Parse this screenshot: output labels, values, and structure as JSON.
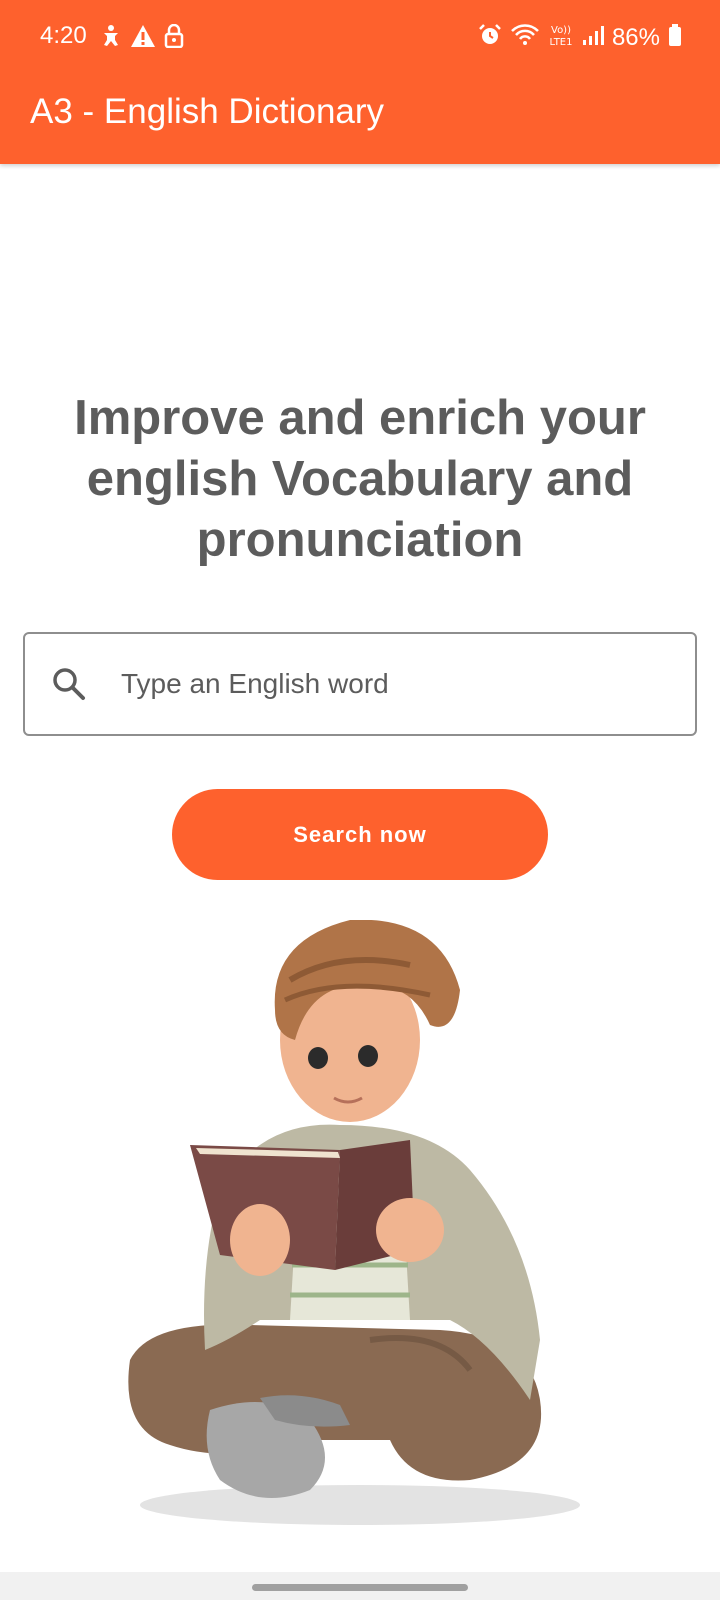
{
  "status_bar": {
    "time": "4:20",
    "battery": "86%",
    "left_icons": [
      "accessibility-icon",
      "warning-icon",
      "lock-icon"
    ],
    "right_icons": [
      "alarm-icon",
      "wifi-icon",
      "volte-icon",
      "signal-icon",
      "battery-icon"
    ],
    "network_badge_top": "Vo))",
    "network_badge_bottom": "LTE1"
  },
  "app_bar": {
    "title": "A3 - English Dictionary",
    "color": "#FE612D"
  },
  "main": {
    "headline": "Improve and enrich your english Vocabulary and pronunciation",
    "search": {
      "placeholder": "Type an English word",
      "value": ""
    },
    "search_button": "Search now",
    "illustration": "boy-reading-book-illustration"
  },
  "colors": {
    "accent": "#FE612D",
    "text_gray": "#5c5c5c",
    "border": "#8e8e8e"
  }
}
